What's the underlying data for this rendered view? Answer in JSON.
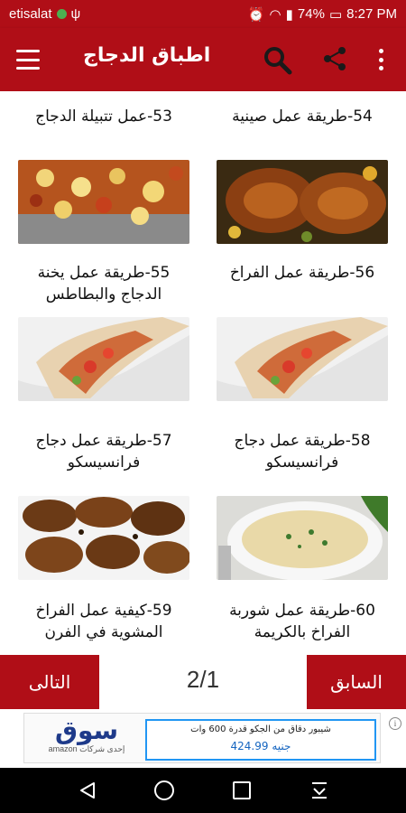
{
  "status": {
    "carrier": "etisalat",
    "battery": "74%",
    "time": "8:27 PM"
  },
  "appbar": {
    "title": "اطباق الدجاج",
    "icons": [
      "menu-icon",
      "search-icon",
      "share-icon",
      "more-vert-icon"
    ]
  },
  "recipes": [
    {
      "label": "53-عمل تتبيلة الدجاج",
      "image": "none"
    },
    {
      "label": "54-طريقة عمل صينية",
      "image": "none"
    },
    {
      "label": "55-طريقة عمل يخنة الدجاج والبطاطس",
      "image": "chicken-potato-stew"
    },
    {
      "label": "56-طريقة عمل الفراخ",
      "image": "roasted-chicken"
    },
    {
      "label": "57-طريقة عمل دجاج فرانسيسكو",
      "image": "chicken-wrap"
    },
    {
      "label": "58-طريقة عمل دجاج فرانسيسكو",
      "image": "chicken-wrap"
    },
    {
      "label": "59-كيفية عمل الفراخ المشوية في الفرن",
      "image": "grilled-chicken"
    },
    {
      "label": "60-طريقة عمل شوربة الفراخ بالكريمة",
      "image": "cream-soup"
    }
  ],
  "pager": {
    "next_label": "التالى",
    "prev_label": "السابق",
    "indicator": "2/1"
  },
  "ad": {
    "brand": "سوق",
    "brand_sub": "amazon إحدى شركات",
    "line1": "شيبور دقاق من الجكو قدرة 600 وات",
    "line2": "جنيه 424.99",
    "info": "i"
  },
  "colors": {
    "primary": "#b00e17",
    "accent": "#2196f3"
  }
}
